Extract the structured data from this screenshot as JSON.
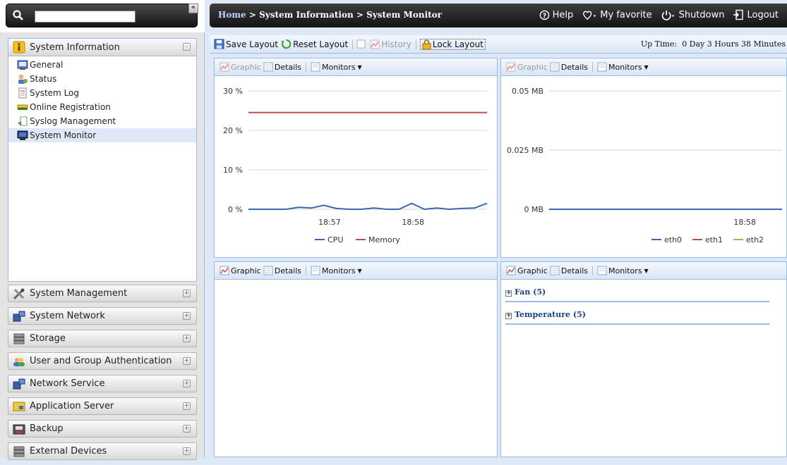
{
  "sidebar": {
    "search": {
      "value": "",
      "placeholder": ""
    },
    "collapse_label": "«",
    "active_section": {
      "label": "System Information",
      "items": [
        {
          "label": "General",
          "icon": "general-icon"
        },
        {
          "label": "Status",
          "icon": "status-icon"
        },
        {
          "label": "System Log",
          "icon": "system-log-icon"
        },
        {
          "label": "Online Registration",
          "icon": "registration-icon"
        },
        {
          "label": "Syslog Management",
          "icon": "syslog-icon"
        },
        {
          "label": "System Monitor",
          "icon": "monitor-icon",
          "selected": true
        }
      ]
    },
    "sections": [
      {
        "label": "System Management",
        "icon": "tools-icon"
      },
      {
        "label": "System Network",
        "icon": "network-icon"
      },
      {
        "label": "Storage",
        "icon": "storage-icon"
      },
      {
        "label": "User and Group Authentication",
        "icon": "users-icon"
      },
      {
        "label": "Network Service",
        "icon": "network-service-icon"
      },
      {
        "label": "Application Server",
        "icon": "app-server-icon"
      },
      {
        "label": "Backup",
        "icon": "backup-icon"
      },
      {
        "label": "External Devices",
        "icon": "external-devices-icon"
      }
    ]
  },
  "header": {
    "breadcrumb": {
      "home": "Home",
      "sep1": " > ",
      "section": "System Information",
      "sep2": " > ",
      "page": "System Monitor"
    },
    "help": "Help",
    "favorite": "My favorite",
    "shutdown": "Shutdown",
    "logout": "Logout"
  },
  "toolbar": {
    "save_layout": "Save Layout",
    "reset_layout": "Reset Layout",
    "history": "History",
    "lock_layout": "Lock Layout",
    "uptime_label": "Up Time:",
    "uptime_value": "0 Day 3 Hours 38 Minutes"
  },
  "panel_toolbar": {
    "graphic": "Graphic",
    "details": "Details",
    "monitors": "Monitors"
  },
  "chart_data": [
    {
      "type": "line",
      "panel": "top-left",
      "x_ticks": [
        "18:57",
        "18:58"
      ],
      "y_ticks": [
        "0 %",
        "10 %",
        "20 %",
        "30 %"
      ],
      "ylim": [
        0,
        30
      ],
      "grid": true,
      "legend_placement": "bottom-center",
      "series": [
        {
          "name": "CPU",
          "color": "#3a67b4",
          "values": [
            0,
            0,
            0,
            0,
            0.5,
            0.3,
            1,
            0.2,
            0,
            0,
            0.3,
            0,
            0,
            1.5,
            0,
            0.3,
            0,
            0.2,
            0.3,
            1.5
          ]
        },
        {
          "name": "Memory",
          "color": "#c0504d",
          "values": [
            24.5,
            24.5,
            24.5,
            24.5,
            24.5,
            24.5,
            24.5,
            24.5,
            24.5,
            24.5,
            24.5,
            24.5,
            24.5,
            24.5,
            24.5,
            24.5,
            24.5,
            24.5,
            24.5,
            24.5
          ]
        }
      ]
    },
    {
      "type": "line",
      "panel": "top-right",
      "x_ticks": [
        "18:58"
      ],
      "y_ticks": [
        "0 MB",
        "0.025 MB",
        "0.05 MB"
      ],
      "ylim": [
        0,
        0.05
      ],
      "grid": true,
      "legend_placement": "bottom-right",
      "series": [
        {
          "name": "eth0",
          "color": "#3a67b4",
          "values": [
            0,
            0,
            0,
            0,
            0,
            0,
            0,
            0,
            0,
            0
          ]
        },
        {
          "name": "eth1",
          "color": "#c0504d",
          "values": [
            0,
            0,
            0,
            0,
            0,
            0,
            0,
            0,
            0,
            0
          ]
        },
        {
          "name": "eth2",
          "color": "#9bbb59",
          "values": [
            0,
            0,
            0,
            0,
            0,
            0,
            0,
            0,
            0,
            0
          ]
        }
      ]
    }
  ],
  "sensors": [
    {
      "label": "Fan (5)"
    },
    {
      "label": "Temperature (5)"
    }
  ]
}
